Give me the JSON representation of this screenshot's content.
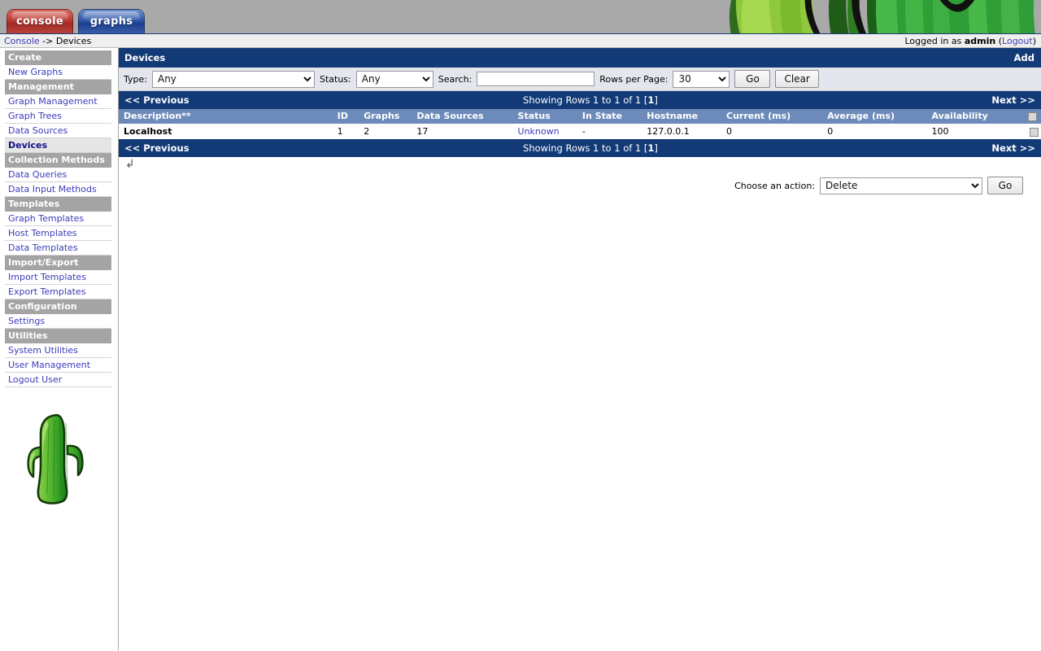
{
  "app": {
    "tabs": [
      {
        "label": "console",
        "name": "tab-console",
        "active": true
      },
      {
        "label": "graphs",
        "name": "tab-graphs",
        "active": false
      }
    ],
    "breadcrumb": {
      "root": "Console",
      "separator": " -> ",
      "current": "Devices"
    },
    "session": {
      "prefix": "Logged in as ",
      "user": "admin",
      "logout_open": " (",
      "logout": "Logout",
      "logout_close": ")"
    },
    "colors": {
      "title_bar": "#123a77",
      "table_header": "#6c8bba",
      "nav_header": "#a4a4a4",
      "link": "#3b3bbb",
      "tab_console": "#a32a25",
      "tab_graphs": "#1e3f8f"
    }
  },
  "sidebar": {
    "groups": [
      {
        "header": "Create",
        "items": [
          {
            "label": "New Graphs",
            "selected": false
          }
        ]
      },
      {
        "header": "Management",
        "items": [
          {
            "label": "Graph Management",
            "selected": false
          },
          {
            "label": "Graph Trees",
            "selected": false
          },
          {
            "label": "Data Sources",
            "selected": false
          },
          {
            "label": "Devices",
            "selected": true
          }
        ]
      },
      {
        "header": "Collection Methods",
        "items": [
          {
            "label": "Data Queries",
            "selected": false
          },
          {
            "label": "Data Input Methods",
            "selected": false
          }
        ]
      },
      {
        "header": "Templates",
        "items": [
          {
            "label": "Graph Templates",
            "selected": false
          },
          {
            "label": "Host Templates",
            "selected": false
          },
          {
            "label": "Data Templates",
            "selected": false
          }
        ]
      },
      {
        "header": "Import/Export",
        "items": [
          {
            "label": "Import Templates",
            "selected": false
          },
          {
            "label": "Export Templates",
            "selected": false
          }
        ]
      },
      {
        "header": "Configuration",
        "items": [
          {
            "label": "Settings",
            "selected": false
          }
        ]
      },
      {
        "header": "Utilities",
        "items": [
          {
            "label": "System Utilities",
            "selected": false
          },
          {
            "label": "User Management",
            "selected": false
          },
          {
            "label": "Logout User",
            "selected": false
          }
        ]
      }
    ]
  },
  "main": {
    "title": "Devices",
    "add_label": "Add",
    "filters": {
      "type_label": "Type:",
      "type_value": "Any",
      "type_options": [
        "Any"
      ],
      "status_label": "Status:",
      "status_value": "Any",
      "status_options": [
        "Any"
      ],
      "search_label": "Search:",
      "search_value": "",
      "search_placeholder": "",
      "rows_label": "Rows per Page:",
      "rows_value": "30",
      "rows_options": [
        "30"
      ],
      "go_label": "Go",
      "clear_label": "Clear"
    },
    "pager": {
      "previous": "<< Previous",
      "showing_prefix": "Showing Rows 1 to 1 of 1 [",
      "showing_page": "1",
      "showing_suffix": "]",
      "next": "Next >>"
    },
    "table": {
      "columns": [
        "Description**",
        "ID",
        "Graphs",
        "Data Sources",
        "Status",
        "In State",
        "Hostname",
        "Current (ms)",
        "Average (ms)",
        "Availability"
      ],
      "rows": [
        {
          "description": "Localhost",
          "id": "1",
          "graphs": "2",
          "data_sources": "17",
          "status": "Unknown",
          "in_state": "-",
          "hostname": "127.0.0.1",
          "current_ms": "0",
          "average_ms": "0",
          "availability": "100",
          "selected": false
        }
      ]
    },
    "actions": {
      "choose_label": "Choose an action:",
      "selected_action": "Delete",
      "options": [
        "Delete"
      ],
      "go_label": "Go"
    }
  }
}
